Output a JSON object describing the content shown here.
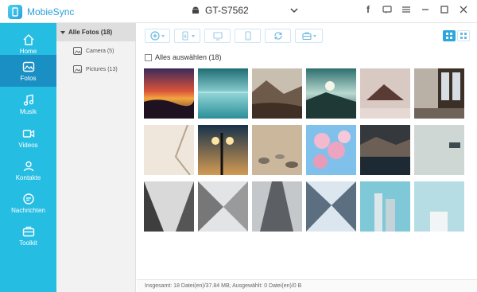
{
  "app": {
    "name": "MobieSync"
  },
  "device": {
    "name": "GT-S7562"
  },
  "window_controls": [
    "facebook-icon",
    "chat-icon",
    "menu-icon",
    "minimize-icon",
    "maximize-icon",
    "close-icon"
  ],
  "sidebar": {
    "items": [
      {
        "label": "Home",
        "icon": "home-icon",
        "active": false
      },
      {
        "label": "Fotos",
        "icon": "photo-icon",
        "active": true
      },
      {
        "label": "Musik",
        "icon": "music-icon",
        "active": false
      },
      {
        "label": "Videos",
        "icon": "video-icon",
        "active": false
      },
      {
        "label": "Kontakte",
        "icon": "contacts-icon",
        "active": false
      },
      {
        "label": "Nachrichten",
        "icon": "messages-icon",
        "active": false
      },
      {
        "label": "Toolkit",
        "icon": "toolkit-icon",
        "active": false
      }
    ]
  },
  "albums": {
    "header": "Alle Fotos (18)",
    "items": [
      {
        "label": "Camera (5)"
      },
      {
        "label": "Pictures (13)"
      }
    ]
  },
  "toolbar": {
    "buttons": [
      "add-icon",
      "export-to-device-icon",
      "export-to-pc-icon",
      "phone-icon",
      "sync-icon",
      "toolbox-icon"
    ]
  },
  "select_all": {
    "label": "Alles auswählen (18)",
    "checked": false
  },
  "status": {
    "text": "Insgesamt: 18 Datei(en)/37.84 MB; Ausgewählt: 0 Datei(en)/0 B"
  },
  "colors": {
    "accent": "#26bde3",
    "active_nav": "#1a8fc4",
    "brand": "#2b9ed8"
  }
}
